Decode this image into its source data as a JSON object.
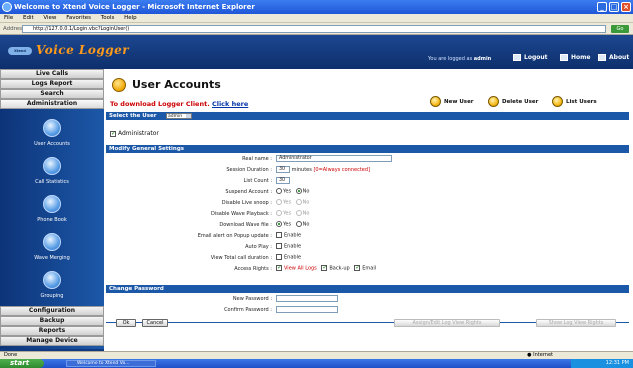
{
  "browser": {
    "title": "Welcome to Xtend Voice Logger - Microsoft Internet Explorer",
    "menu": [
      "File",
      "Edit",
      "View",
      "Favorites",
      "Tools",
      "Help"
    ],
    "address_label": "Address",
    "address": "http://127.0.0.1/Login.vbc?LoginUser()",
    "go_label": "Go",
    "status_left": "Done",
    "status_zone": "Internet"
  },
  "header": {
    "logo_text": "Xtend",
    "app_title": "Voice Logger",
    "logged_prefix": "You are logged as",
    "logged_user": "admin",
    "logout": "Logout",
    "home": "Home",
    "about": "About"
  },
  "sidebar": {
    "top_tabs": [
      "Live Calls",
      "Logs Report",
      "Search",
      "Administration"
    ],
    "icons": [
      "User Accounts",
      "Call Statistics",
      "Phone Book",
      "Wave Merging",
      "Grouping"
    ],
    "bottom_tabs": [
      "Configuration",
      "Backup",
      "Reports",
      "Manage Device"
    ]
  },
  "main": {
    "title": "User Accounts",
    "download_text": "To download Logger Client.",
    "download_link": "Click here",
    "actions": [
      "New User",
      "Delete User",
      "List Users"
    ],
    "select_user_label": "Select the User",
    "select_user_value": "admin",
    "admin_checkbox_label": "Administrator",
    "general_section": "Modify General Settings",
    "fields": {
      "real_name_label": "Real name :",
      "real_name_value": "Administrator",
      "session_label": "Session Duration :",
      "session_value": "30",
      "session_unit": "minutes",
      "session_note": "[0=Always connected]",
      "list_count_label": "List Count :",
      "list_count_value": "30",
      "suspend_label": "Suspend Account :",
      "live_snoop_label": "Disable Live snoop :",
      "wave_playback_label": "Disable Wave Playback :",
      "download_wave_label": "Download Wave file :",
      "email_alert_label": "Email alert on Popup update :",
      "auto_play_label": "Auto Play :",
      "view_total_label": "View Total call duration :",
      "access_rights_label": "Access Rights :",
      "yes": "Yes",
      "no": "No",
      "enable": "Enable",
      "view_all_logs": "View All Logs",
      "backup": "Back-up",
      "email": "Email"
    },
    "password_section": "Change Password",
    "new_password_label": "New Password :",
    "confirm_password_label": "Confirm Password :",
    "ok_button": "Ok",
    "cancel_button": "Cancel",
    "assign_button": "Assign/Edit Log View Rights",
    "show_rights_button": "Show Log View Rights"
  },
  "taskbar": {
    "start": "start",
    "task_item": "Welcome to Xtend Vo...",
    "clock": "12:31 PM"
  }
}
